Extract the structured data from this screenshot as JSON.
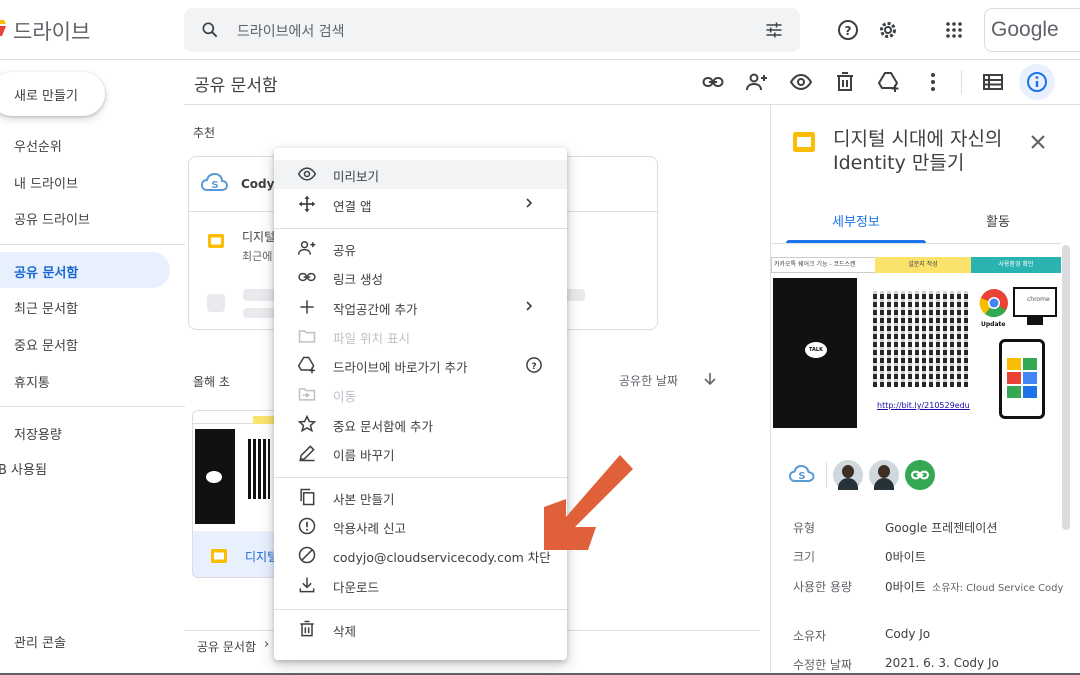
{
  "app": {
    "title": "드라이브",
    "search_placeholder": "드라이브에서 검색",
    "account_label": "Google",
    "brand_colors": {
      "blue": "#1a73e8",
      "yellow": "#fbbc04",
      "green": "#34a853",
      "red": "#ea4335"
    }
  },
  "sidebar": {
    "new_button": "새로 만들기",
    "items": [
      {
        "label": "우선순위"
      },
      {
        "label": "내 드라이브"
      },
      {
        "label": "공유 드라이브"
      },
      {
        "label": "공유 문서함",
        "active": true
      },
      {
        "label": "최근 문서함"
      },
      {
        "label": "중요 문서함"
      },
      {
        "label": "휴지통"
      },
      {
        "label": "저장용량"
      },
      {
        "label": "B 사용됨"
      }
    ],
    "admin_console": "관리 콘솔"
  },
  "main": {
    "title": "공유 문서함",
    "recommended_label": "추천",
    "rec_card": {
      "owner": "Cody .",
      "file_title": "디지털",
      "file_sub": "최근에"
    },
    "group_label": "올해 초",
    "sort_label": "공유한 날짜",
    "file_card": {
      "name": "디지털"
    },
    "breadcrumb": "공유 문서함"
  },
  "context_menu": {
    "items": [
      {
        "label": "미리보기",
        "icon": "eye-icon"
      },
      {
        "label": "연결 앱",
        "icon": "move-icon",
        "submenu": true
      },
      {
        "label": "공유",
        "icon": "person-add-icon"
      },
      {
        "label": "링크 생성",
        "icon": "link-icon"
      },
      {
        "label": "작업공간에 추가",
        "icon": "plus-icon",
        "submenu": true
      },
      {
        "label": "파일 위치 표시",
        "icon": "folder-icon",
        "disabled": true
      },
      {
        "label": "드라이브에 바로가기 추가",
        "icon": "drive-add-icon",
        "help": true
      },
      {
        "label": "이동",
        "icon": "move-to-icon",
        "disabled": true
      },
      {
        "label": "중요 문서함에 추가",
        "icon": "star-icon"
      },
      {
        "label": "이름 바꾸기",
        "icon": "pencil-icon"
      },
      {
        "label": "사본 만들기",
        "icon": "copy-icon"
      },
      {
        "label": "악용사례 신고",
        "icon": "report-icon"
      },
      {
        "label": "codyjo@cloudservicecody.com 차단",
        "icon": "block-icon"
      },
      {
        "label": "다운로드",
        "icon": "download-icon"
      },
      {
        "label": "삭제",
        "icon": "trash-icon"
      }
    ]
  },
  "details_panel": {
    "title": "디지털 시대에 자신의 Identity 만들기",
    "tabs": [
      "세부정보",
      "활동"
    ],
    "preview": {
      "banner": [
        "카카오톡 쉐어크 기능 - 코드스캔",
        "설문지 작성",
        "사용환경 확인"
      ],
      "phone_label": "TALK",
      "update_label": "Update",
      "chrome_label": "chrome",
      "link": "http://bit.ly/210529edu"
    },
    "props": [
      {
        "label": "유형",
        "value": "Google 프레젠테이션"
      },
      {
        "label": "크기",
        "value": "0바이트"
      },
      {
        "label": "사용한 용량",
        "value": "0바이트",
        "extra": "소유자: Cloud Service Cody"
      },
      {
        "label": "소유자",
        "value": "Cody Jo"
      },
      {
        "label": "수정한 날짜",
        "value": "2021. 6. 3. Cody Jo"
      }
    ]
  }
}
